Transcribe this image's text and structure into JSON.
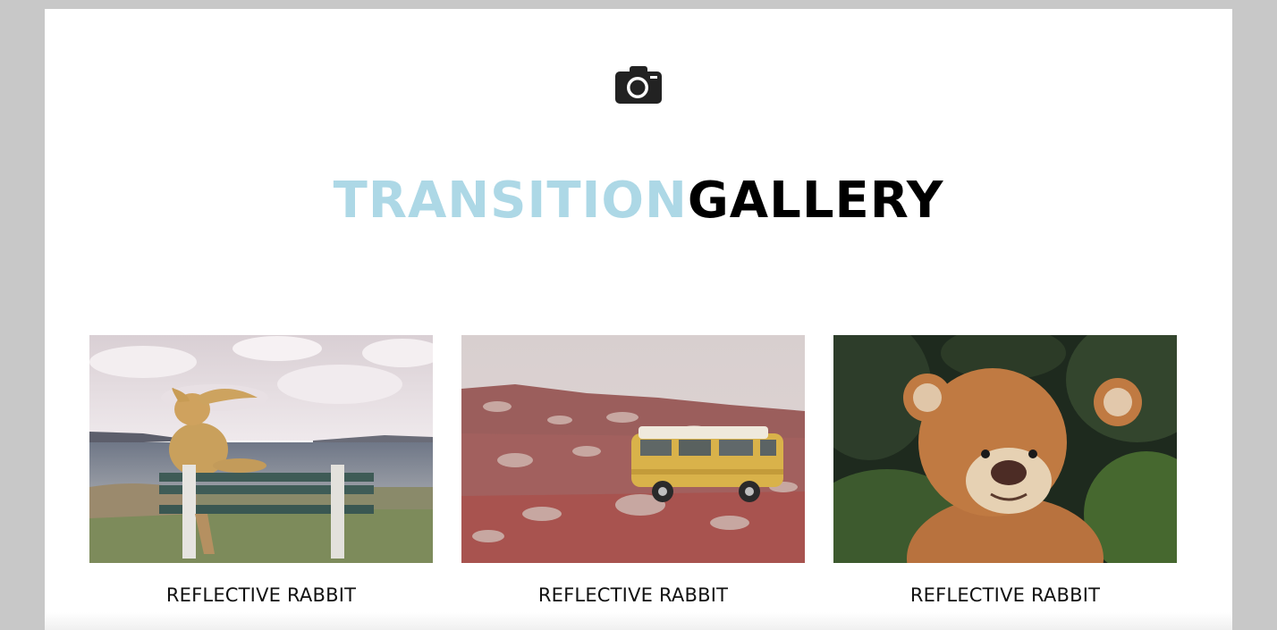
{
  "header": {
    "icon": "camera-icon",
    "title_accent": "TRANSITION",
    "title_main": "GALLERY",
    "accent_color": "#add8e6"
  },
  "gallery": {
    "items": [
      {
        "caption": "REFLECTIVE RABBIT",
        "image": "rabbit-on-bench"
      },
      {
        "caption": "REFLECTIVE RABBIT",
        "image": "yellow-van-on-rocks"
      },
      {
        "caption": "REFLECTIVE RABBIT",
        "image": "teddy-bear-forest"
      }
    ]
  }
}
